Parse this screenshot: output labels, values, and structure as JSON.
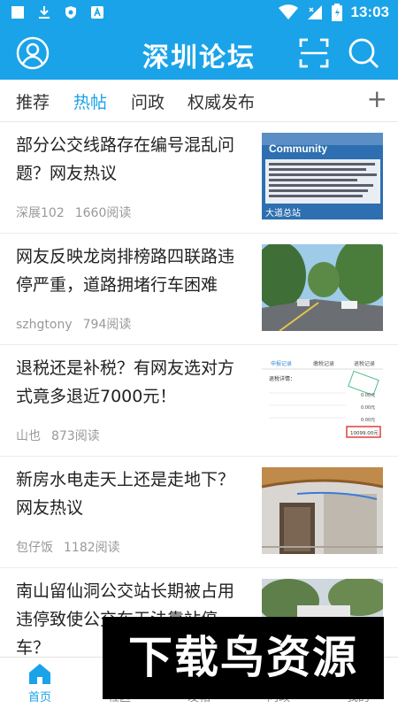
{
  "status_bar": {
    "time": "13:03",
    "left_icons": [
      "square-icon",
      "download-icon",
      "shield-icon",
      "a-icon"
    ],
    "right_icons": [
      "wifi-icon",
      "signal-icon",
      "battery-icon"
    ]
  },
  "header": {
    "title": "深圳论坛",
    "left_icon": "user-icon",
    "right_icons": [
      "scan-icon",
      "search-icon"
    ],
    "bg_color": "#1aa3e8"
  },
  "tabs": {
    "items": [
      {
        "label": "推荐",
        "active": false
      },
      {
        "label": "热帖",
        "active": true
      },
      {
        "label": "问政",
        "active": false
      },
      {
        "label": "权威发布",
        "active": false
      }
    ],
    "add_label": "+"
  },
  "feed": [
    {
      "title": "部分公交线路存在编号混乱问题？网友热议",
      "author": "深展102",
      "reads": "1660阅读"
    },
    {
      "title": "网友反映龙岗排榜路四联路违停严重，道路拥堵行车困难",
      "author": "szhgtony",
      "reads": "794阅读"
    },
    {
      "title": "退税还是补税？有网友选对方式竟多退近7000元！",
      "author": "山也",
      "reads": "873阅读"
    },
    {
      "title": "新房水电走天上还是走地下？网友热议",
      "author": "包仔饭",
      "reads": "1182阅读"
    },
    {
      "title": "南山留仙洞公交站长期被占用违停致使公交车无法靠站停车？",
      "author": "",
      "reads": ""
    }
  ],
  "thumb_texts": {
    "bus_sign_line1": "Community",
    "bus_sign_line2": "大道总站",
    "tax_tab1": "申报记录",
    "tax_tab2": "缴税记录",
    "tax_tab3": "退税记录",
    "tax_heading": "退税详情：",
    "tax_row1": "0.00元",
    "tax_row2": "0.00元",
    "tax_row3": "0.00元",
    "tax_highlight": "10099.00元"
  },
  "bottom_nav": {
    "items": [
      {
        "label": "首页",
        "icon": "home-icon",
        "active": true
      },
      {
        "label": "社区",
        "icon": "community-icon",
        "active": false
      },
      {
        "label": "发帖",
        "icon": "post-icon",
        "active": false
      },
      {
        "label": "问政",
        "icon": "question-icon",
        "active": false
      },
      {
        "label": "我的",
        "icon": "profile-icon",
        "active": false
      }
    ]
  },
  "watermark": "下载鸟资源"
}
